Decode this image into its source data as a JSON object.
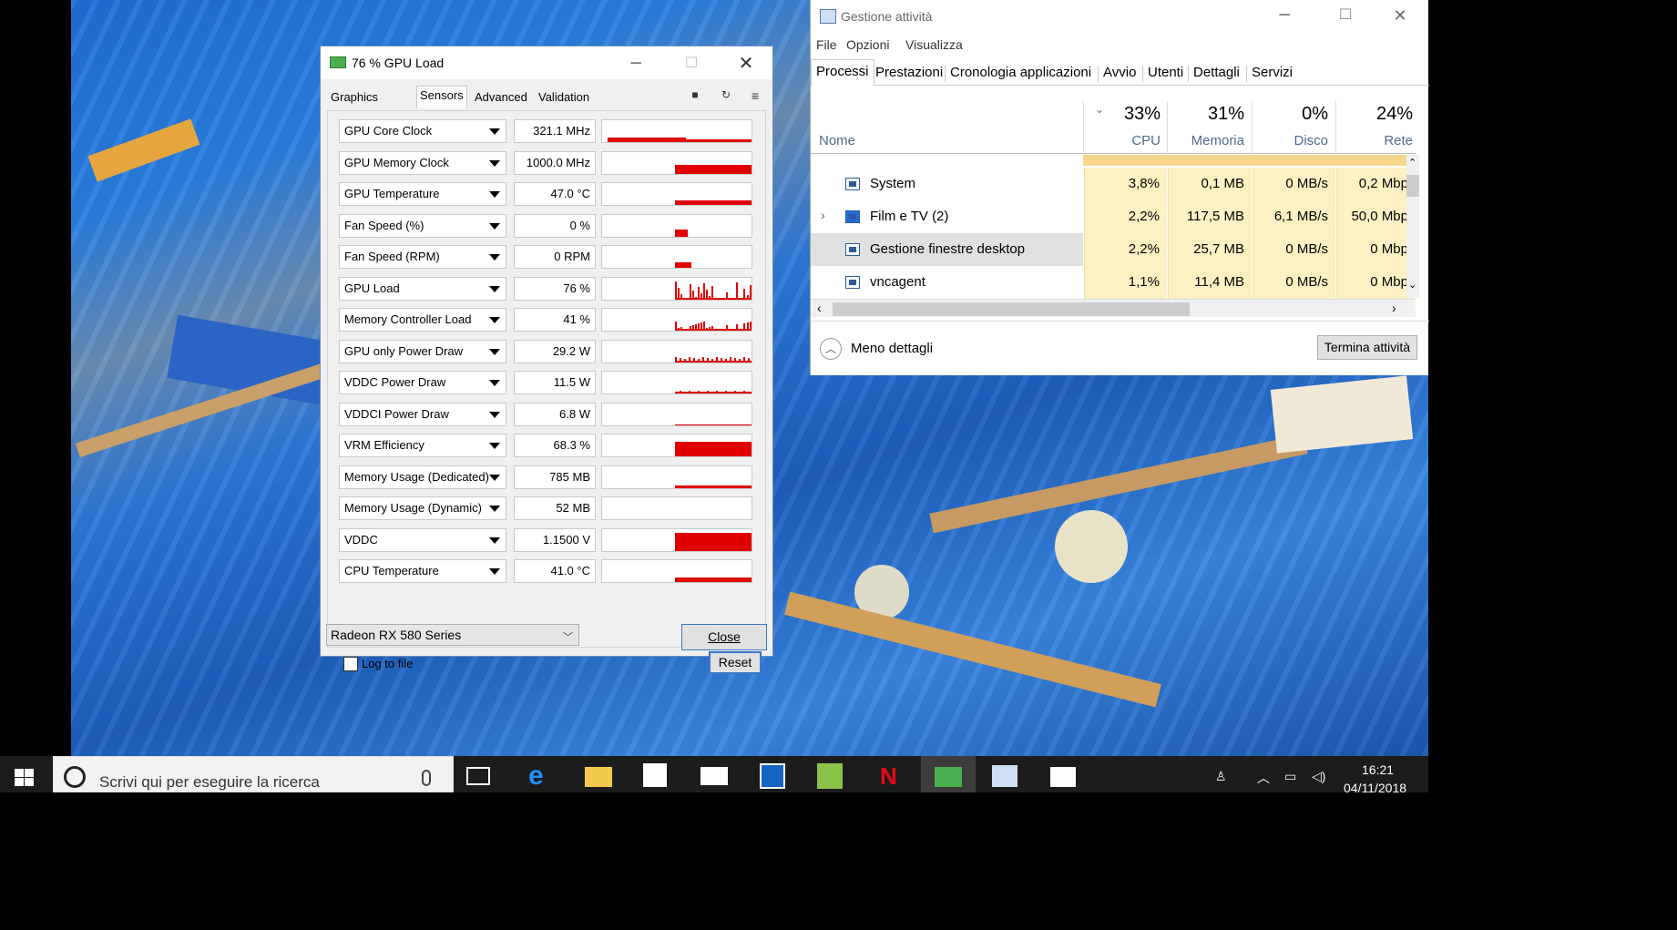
{
  "gpuz": {
    "title": "76 % GPU Load",
    "tabs": [
      "Graphics Card",
      "Sensors",
      "Advanced",
      "Validation"
    ],
    "active_tab": "Sensors",
    "sensors": [
      {
        "name": "GPU Core Clock",
        "value": "321.1 MHz"
      },
      {
        "name": "GPU Memory Clock",
        "value": "1000.0 MHz"
      },
      {
        "name": "GPU Temperature",
        "value": "47.0 °C"
      },
      {
        "name": "Fan Speed (%)",
        "value": "0 %"
      },
      {
        "name": "Fan Speed (RPM)",
        "value": "0 RPM"
      },
      {
        "name": "GPU Load",
        "value": "76 %"
      },
      {
        "name": "Memory Controller Load",
        "value": "41 %"
      },
      {
        "name": "GPU only Power Draw",
        "value": "29.2 W"
      },
      {
        "name": "VDDC Power Draw",
        "value": "11.5 W"
      },
      {
        "name": "VDDCI Power Draw",
        "value": "6.8 W"
      },
      {
        "name": "VRM Efficiency",
        "value": "68.3 %"
      },
      {
        "name": "Memory Usage (Dedicated)",
        "value": "785 MB"
      },
      {
        "name": "Memory Usage (Dynamic)",
        "value": "52 MB"
      },
      {
        "name": "VDDC",
        "value": "1.1500 V"
      },
      {
        "name": "CPU Temperature",
        "value": "41.0 °C"
      }
    ],
    "log_to_file_label": "Log to file",
    "log_to_file_checked": false,
    "reset_label": "Reset",
    "gpu_select_value": "Radeon RX 580 Series",
    "close_label": "Close",
    "graph_color": "#e00000"
  },
  "taskmgr": {
    "title": "Gestione attività",
    "menu": [
      "File",
      "Opzioni",
      "Visualizza"
    ],
    "tabs": [
      "Processi",
      "Prestazioni",
      "Cronologia applicazioni",
      "Avvio",
      "Utenti",
      "Dettagli",
      "Servizi"
    ],
    "active_tab": "Processi",
    "columns": {
      "name": "Nome",
      "cpu": {
        "pct": "33%",
        "label": "CPU"
      },
      "memory": {
        "pct": "31%",
        "label": "Memoria"
      },
      "disk": {
        "pct": "0%",
        "label": "Disco"
      },
      "network": {
        "pct": "24%",
        "label": "Rete"
      }
    },
    "rows": [
      {
        "name": "System",
        "cpu": "3,8%",
        "memory": "0,1 MB",
        "disk": "0 MB/s",
        "network": "0,2 Mbp",
        "expandable": false,
        "selected": false
      },
      {
        "name": "Film e TV (2)",
        "cpu": "2,2%",
        "memory": "117,5 MB",
        "disk": "6,1 MB/s",
        "network": "50,0 Mbp",
        "expandable": true,
        "selected": false
      },
      {
        "name": "Gestione finestre desktop",
        "cpu": "2,2%",
        "memory": "25,7 MB",
        "disk": "0 MB/s",
        "network": "0 Mbp",
        "expandable": false,
        "selected": true
      },
      {
        "name": "vncagent",
        "cpu": "1,1%",
        "memory": "11,4 MB",
        "disk": "0 MB/s",
        "network": "0 Mbp",
        "expandable": false,
        "selected": false
      }
    ],
    "less_details_label": "Meno dettagli",
    "end_task_label": "Termina attività",
    "cell_highlight": "#fdf1c4"
  },
  "taskbar": {
    "search_placeholder": "Scrivi qui per eseguire la ricerca",
    "time": "16:21",
    "date": "04/11/2018",
    "apps": [
      "task-view-icon",
      "edge-icon",
      "file-explorer-icon",
      "store-icon",
      "mail-icon",
      "app-blue-icon",
      "app-green-icon",
      "netflix-icon",
      "gpuz-icon",
      "task-manager-icon",
      "film-tv-icon"
    ]
  }
}
